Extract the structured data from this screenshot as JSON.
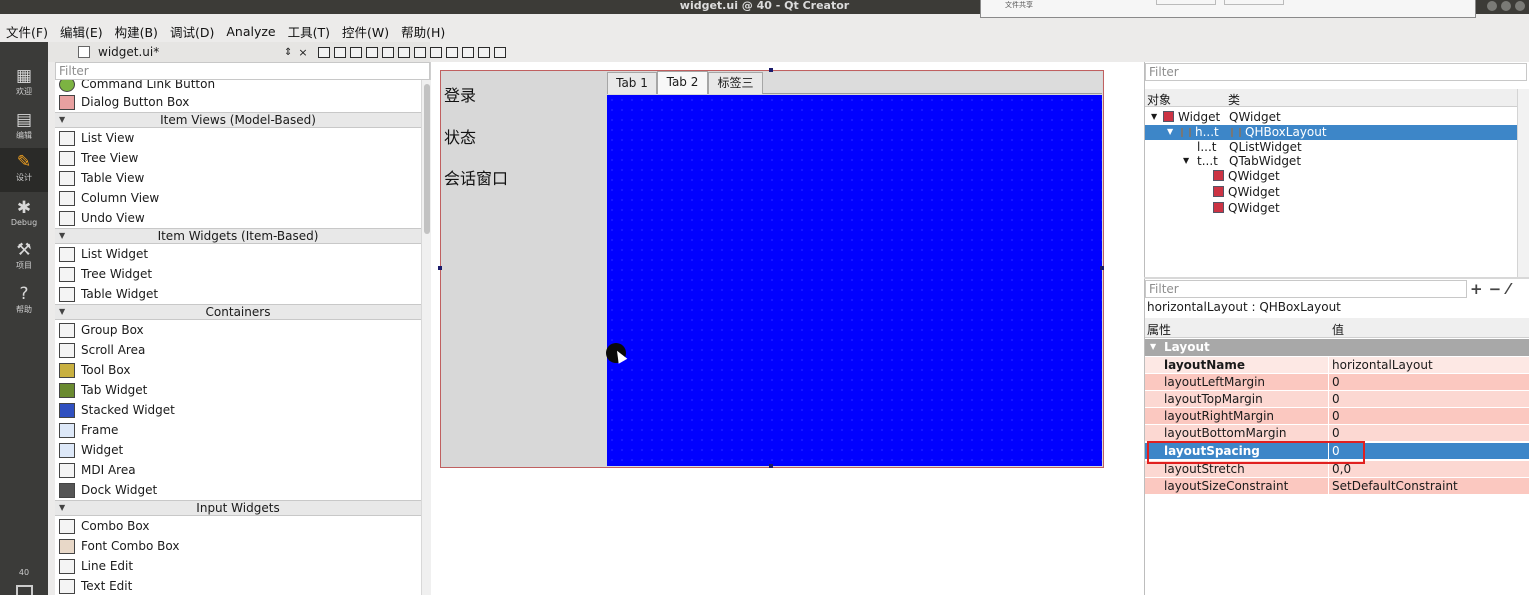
{
  "window": {
    "title": "widget.ui @ 40 - Qt Creator",
    "popup_text": "文件共享"
  },
  "menubar": [
    "文件(F)",
    "编辑(E)",
    "构建(B)",
    "调试(D)",
    "Analyze",
    "工具(T)",
    "控件(W)",
    "帮助(H)"
  ],
  "modes": [
    {
      "label": "欢迎",
      "icon": "grid-icon"
    },
    {
      "label": "编辑",
      "icon": "document-icon"
    },
    {
      "label": "设计",
      "icon": "pencil-icon"
    },
    {
      "label": "Debug",
      "icon": "bug-icon"
    },
    {
      "label": "项目",
      "icon": "wrench-icon"
    },
    {
      "label": "帮助",
      "icon": "help-icon"
    }
  ],
  "mode_number": "40",
  "editor": {
    "file_name": "widget.ui*",
    "arrows": "⇕",
    "close": "×"
  },
  "widgetbox": {
    "filter_placeholder": "Filter",
    "items": {
      "command_link": "Command Link Button",
      "dialog_button_box": "Dialog Button Box",
      "cat_item_views": "Item Views (Model-Based)",
      "list_view": "List View",
      "tree_view": "Tree View",
      "table_view": "Table View",
      "column_view": "Column View",
      "undo_view": "Undo View",
      "cat_item_widgets": "Item Widgets (Item-Based)",
      "list_widget": "List Widget",
      "tree_widget": "Tree Widget",
      "table_widget": "Table Widget",
      "cat_containers": "Containers",
      "group_box": "Group Box",
      "scroll_area": "Scroll Area",
      "tool_box": "Tool Box",
      "tab_widget": "Tab Widget",
      "stacked_widget": "Stacked Widget",
      "frame": "Frame",
      "widget": "Widget",
      "mdi_area": "MDI Area",
      "dock_widget": "Dock Widget",
      "cat_input_widgets": "Input Widgets",
      "combo_box": "Combo Box",
      "font_combo_box": "Font Combo Box",
      "line_edit": "Line Edit",
      "text_edit": "Text Edit"
    }
  },
  "form": {
    "labels": [
      "登录",
      "状态",
      "会话窗口"
    ],
    "tabs": [
      "Tab 1",
      "Tab 2",
      "标签三"
    ],
    "active_tab": 1,
    "tab_page_color": "#0000ff"
  },
  "object_inspector": {
    "filter_placeholder": "Filter",
    "col_object": "对象",
    "col_class": "类",
    "rows": [
      {
        "name": "Widget",
        "class": "QWidget"
      },
      {
        "name": "h...t",
        "class": "QHBoxLayout"
      },
      {
        "name": "l...t",
        "class": "QListWidget"
      },
      {
        "name": "t...t",
        "class": "QTabWidget"
      },
      {
        "name": "",
        "class": "QWidget"
      },
      {
        "name": "",
        "class": "QWidget"
      },
      {
        "name": "",
        "class": "QWidget"
      }
    ]
  },
  "property_editor": {
    "filter_placeholder": "Filter",
    "object_class": "horizontalLayout : QHBoxLayout",
    "col_property": "属性",
    "col_value": "值",
    "group": "Layout",
    "rows": [
      {
        "name": "layoutName",
        "value": "horizontalLayout"
      },
      {
        "name": "layoutLeftMargin",
        "value": "0"
      },
      {
        "name": "layoutTopMargin",
        "value": "0"
      },
      {
        "name": "layoutRightMargin",
        "value": "0"
      },
      {
        "name": "layoutBottomMargin",
        "value": "0"
      },
      {
        "name": "layoutSpacing",
        "value": "0"
      },
      {
        "name": "layoutStretch",
        "value": "0,0"
      },
      {
        "name": "layoutSizeConstraint",
        "value": "SetDefaultConstraint"
      }
    ]
  },
  "colors": {
    "selection": "#3d86c8",
    "highlight_box": "#e02020",
    "property_pink": "#fbc8c0"
  }
}
